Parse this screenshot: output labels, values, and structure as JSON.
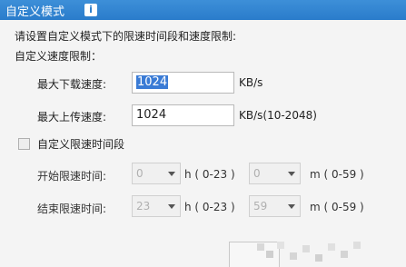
{
  "window": {
    "title": "自定义模式"
  },
  "intro": "请设置自定义模式下的限速时间段和速度限制:",
  "speed_section": {
    "label": "自定义速度限制："
  },
  "download": {
    "label": "最大下载速度:",
    "value": "1024",
    "unit": "KB/s"
  },
  "upload": {
    "label": "最大上传速度:",
    "value": "1024",
    "unit": "KB/s(10-2048)"
  },
  "time_section": {
    "label": "自定义限速时间段",
    "checked": false
  },
  "start": {
    "label": "开始限速时间:",
    "hour": "0",
    "h_unit": "h ( 0-23 )",
    "minute": "0",
    "m_unit": "m ( 0-59 )"
  },
  "end": {
    "label": "结束限速时间:",
    "hour": "23",
    "h_unit": "h ( 0-23 )",
    "minute": "59",
    "m_unit": "m ( 0-59 )"
  }
}
